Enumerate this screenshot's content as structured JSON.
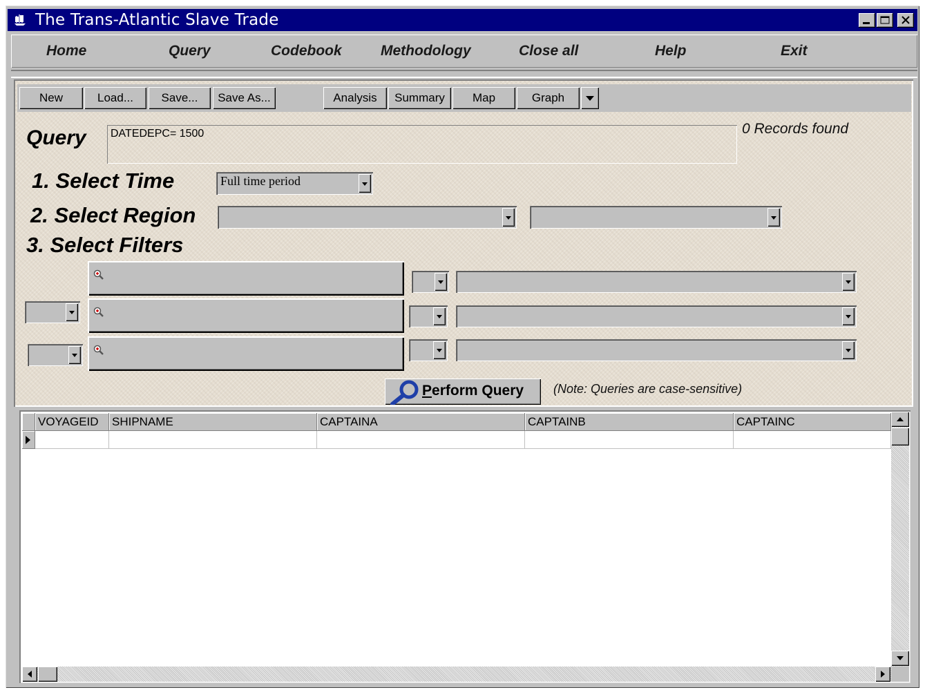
{
  "window": {
    "title": "The Trans-Atlantic Slave Trade",
    "app_icon": "ship-icon",
    "controls": [
      "minimize-icon",
      "maximize-icon",
      "close-icon"
    ]
  },
  "menu": {
    "items": [
      "Home",
      "Query",
      "Codebook",
      "Methodology",
      "Close all",
      "Help",
      "Exit"
    ]
  },
  "toolbar": {
    "new": "New",
    "load": "Load...",
    "save": "Save...",
    "save_as": "Save As...",
    "analysis": "Analysis",
    "summary": "Summary",
    "map": "Map",
    "graph": "Graph"
  },
  "query": {
    "label": "Query",
    "value": "DATEDEPC= 1500",
    "records_found": "0 Records found"
  },
  "steps": {
    "time_label": "1. Select Time",
    "time_value": "Full time period",
    "region_label": "2. Select Region",
    "filters_label": "3. Select Filters"
  },
  "perform": {
    "label_underlined": "P",
    "label_rest": "erform Query",
    "note": "(Note: Queries are case-sensitive)"
  },
  "grid": {
    "columns": [
      "VOYAGEID",
      "SHIPNAME",
      "CAPTAINA",
      "CAPTAINB",
      "CAPTAINC"
    ]
  },
  "colors": {
    "titlebar": "#000080",
    "chrome": "#c0c0c0",
    "panel_bg": "#e5ddd0",
    "magnifier": "#1f3fa8"
  }
}
